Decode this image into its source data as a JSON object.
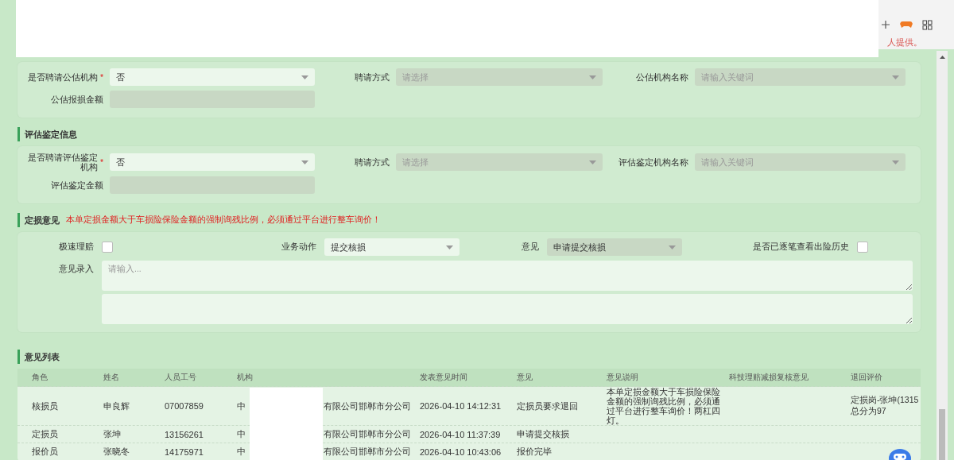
{
  "browser": {
    "notice": "人提供。"
  },
  "sections": [
    {
      "rows": [
        [
          {
            "kind": "select",
            "label": "是否聘请公估机构",
            "mark": "*",
            "value": "否",
            "disabled": false
          },
          {
            "kind": "select",
            "label": "聘请方式",
            "placeholder": "请选择",
            "disabled": true
          },
          {
            "kind": "select",
            "label": "公估机构名称",
            "placeholder": "请输入关键词",
            "disabled": true
          }
        ],
        [
          {
            "kind": "input",
            "label": "公估报损金额",
            "disabled": true
          }
        ]
      ]
    },
    {
      "title": "评估鉴定信息",
      "rows": [
        [
          {
            "kind": "select",
            "label": "是否聘请评估鉴定机构",
            "mark": "*",
            "value": "否",
            "disabled": false
          },
          {
            "kind": "select",
            "label": "聘请方式",
            "placeholder": "请选择",
            "disabled": true
          },
          {
            "kind": "select",
            "label": "评估鉴定机构名称",
            "placeholder": "请输入关键词",
            "disabled": true
          }
        ],
        [
          {
            "kind": "input",
            "label": "评估鉴定金额",
            "disabled": true
          }
        ]
      ]
    },
    {
      "title": "定损意见",
      "warning": "本单定损金额大于车损险保险金额的强制询残比例，必须通过平台进行整车询价！",
      "opinion_row": [
        {
          "kind": "checkbox",
          "label": "极速理赔",
          "checked": false
        },
        {
          "kind": "select",
          "label": "业务动作",
          "value": "提交核损",
          "disabled": false
        },
        {
          "kind": "select",
          "label": "意见",
          "value": "申请提交核损",
          "disabled": true
        },
        {
          "kind": "checkbox",
          "label": "是否已逐笔查看出险历史",
          "checked": false
        }
      ],
      "textareas": [
        {
          "kind": "textarea",
          "label": "意见录入",
          "placeholder": "请输入..."
        },
        {
          "kind": "textarea"
        }
      ]
    }
  ],
  "table": {
    "title": "意见列表",
    "columns": [
      "角色",
      "姓名",
      "人员工号",
      "机构",
      "发表意见时间",
      "意见",
      "意见说明",
      "科技理赔减损复核意见",
      "退回评价"
    ],
    "rows": [
      {
        "role": "核损员",
        "name": "申良辉",
        "id": "07007859",
        "org_start": "中",
        "org_end": "有限公司邯郸市分公司",
        "time": "2026-04-10 14:12:31",
        "opinion": "定损员要求退回",
        "note": "本单定损金额大于车损险保险金额的强制询残比例，必须通过平台进行整车询价！两杠四灯。",
        "rating": [
          "定损岗-张坤(1315",
          "总分为97"
        ]
      },
      {
        "role": "定损员",
        "name": "张坤",
        "id": "13156261",
        "org_start": "中",
        "org_end": "有限公司邯郸市分公司",
        "time": "2026-04-10 11:37:39",
        "opinion": "申请提交核损"
      },
      {
        "role": "报价员",
        "name": "张晓冬",
        "id": "14175971",
        "org_start": "中",
        "org_end": "有限公司邯郸市分公司",
        "time": "2026-04-10 10:43:06",
        "opinion": "报价完毕"
      }
    ]
  }
}
